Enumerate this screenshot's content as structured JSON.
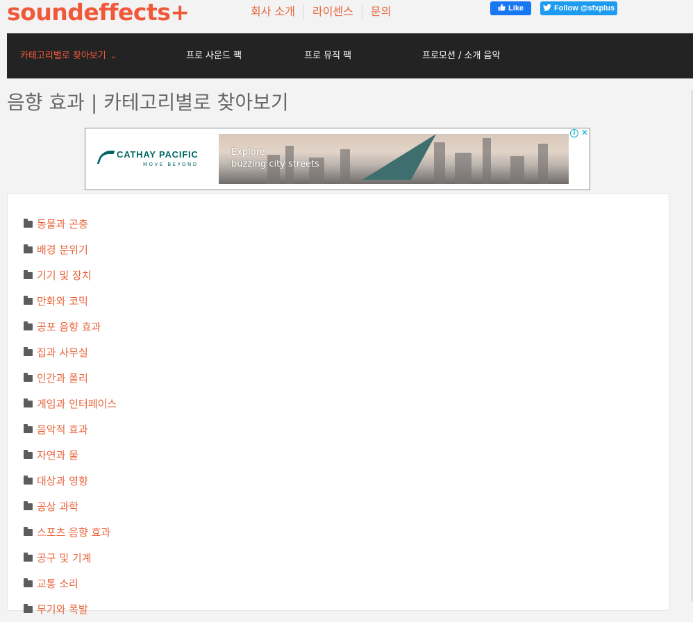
{
  "site": {
    "logo": "soundeffects+"
  },
  "top_links": [
    "회사 소개",
    "라이센스",
    "문의"
  ],
  "social": {
    "facebook_label": "Like",
    "twitter_label": "Follow @sfxplus"
  },
  "nav": {
    "items": [
      {
        "label": "카테고리별로 찾아보기",
        "active": true
      },
      {
        "label": "프로 사운드 팩"
      },
      {
        "label": "프로 뮤직 팩"
      },
      {
        "label": "프로모션 / 소개 음악"
      }
    ]
  },
  "page": {
    "title": "음향 효과 | 카테고리별로 찾아보기"
  },
  "ad": {
    "brand": "CATHAY PACIFIC",
    "tagline": "MOVE BEYOND",
    "headline_1": "Explore",
    "headline_2": "buzzing city streets"
  },
  "categories": [
    "동물과 곤충",
    "배경 분위기",
    "기기 및 장치",
    "만화와 코믹",
    "공포 음향 효과",
    "집과 사무실",
    "인간과 폴리",
    "게임과 인터페이스",
    "음악적 효과",
    "자연과 물",
    "대상과 영향",
    "공상 과학",
    "스포츠 음향 효과",
    "공구 및 기계",
    "교통 소리",
    "무기와 폭발"
  ],
  "colors": {
    "accent": "#f0583a",
    "link": "#e8643c",
    "nav_bg": "#232323",
    "folder_icon": "#5c5c5c"
  }
}
